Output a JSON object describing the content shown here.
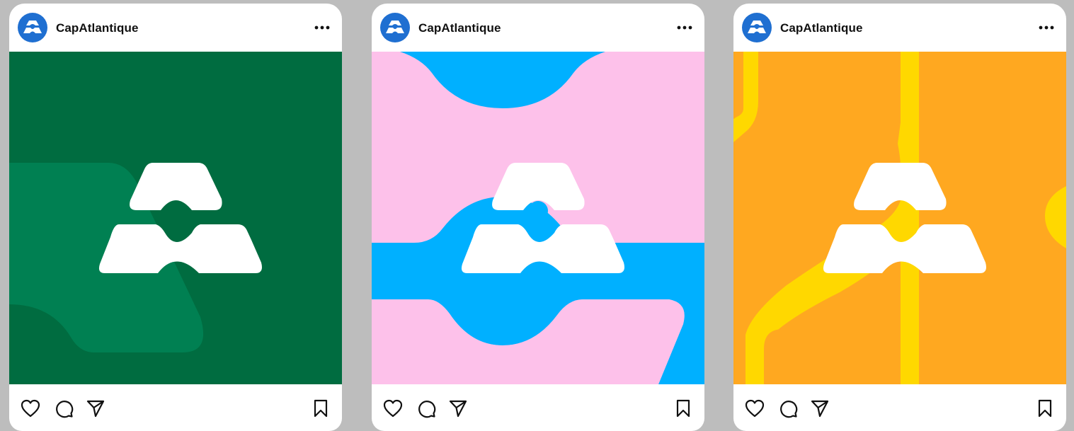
{
  "feed": {
    "posts": [
      {
        "account_name": "CapAtlantique",
        "avatar_icon": "capatlantique-logo-icon",
        "artwork_colors": {
          "background": "#006c40",
          "shape": "#008052",
          "logo": "#ffffff"
        },
        "actions": {
          "like": "heart-icon",
          "comment": "comment-icon",
          "share": "send-icon",
          "save": "bookmark-icon"
        }
      },
      {
        "account_name": "CapAtlantique",
        "avatar_icon": "capatlantique-logo-icon",
        "artwork_colors": {
          "background": "#fdc1ea",
          "shape": "#00b0ff",
          "logo": "#ffffff"
        },
        "actions": {
          "like": "heart-icon",
          "comment": "comment-icon",
          "share": "send-icon",
          "save": "bookmark-icon"
        }
      },
      {
        "account_name": "CapAtlantique",
        "avatar_icon": "capatlantique-logo-icon",
        "artwork_colors": {
          "background": "#ffa820",
          "shape": "#ffd800",
          "logo": "#ffffff"
        },
        "actions": {
          "like": "heart-icon",
          "comment": "comment-icon",
          "share": "send-icon",
          "save": "bookmark-icon"
        }
      }
    ],
    "avatar_color": "#1f6fd1"
  }
}
